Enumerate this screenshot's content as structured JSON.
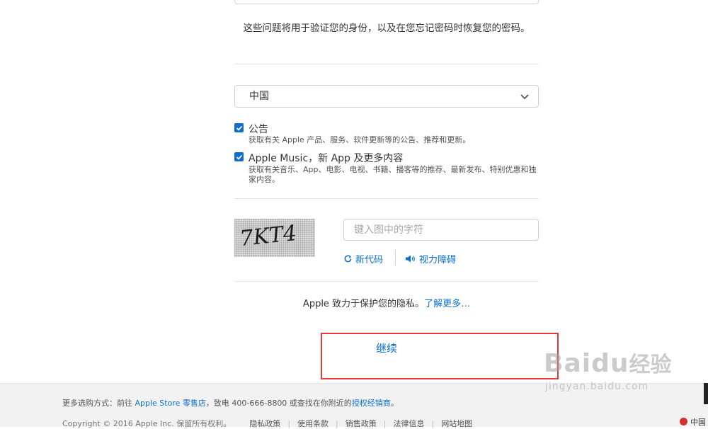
{
  "security_note": "这些问题将用于验证您的身份，以及在您忘记密码时恢复您的密码。",
  "country_select": {
    "value": "中国"
  },
  "subscriptions": [
    {
      "title": "公告",
      "subtitle": "获取有关 Apple 产品、服务、软件更新等的公告、推荐和更新。",
      "checked": true
    },
    {
      "title": "Apple Music，新 App 及更多内容",
      "subtitle": "获取有关音乐、App、电影、电视、书籍、播客等的推荐、最新发布、特别优惠和独家内容。",
      "checked": true
    }
  ],
  "captcha": {
    "image_text": "7KT4",
    "input_placeholder": "键入图中的字符",
    "new_code_label": "新代码",
    "audio_label": "视力障碍"
  },
  "privacy": {
    "text": "Apple 致力于保护您的隐私。",
    "link": "了解更多…"
  },
  "continue_label": "继续",
  "footer": {
    "line1": {
      "prefix": "更多选购方式：前往 ",
      "store_link": "Apple Store 零售店",
      "middle": "，致电 400-666-8800 或查找在你附近的",
      "dealer_link": "授权经销商",
      "suffix": "。"
    },
    "copyright": "Copyright © 2016 Apple Inc. 保留所有权利。",
    "links": [
      "隐私政策",
      "使用条款",
      "销售政策",
      "法律信息",
      "网站地图"
    ],
    "region": "中国"
  },
  "watermark": {
    "brand": "Baidu",
    "cn": "经验",
    "url": "jingyan.baidu.com"
  },
  "colors": {
    "accent": "#0a6fd1",
    "checkbox": "#0f6ecd",
    "highlight_box": "#e53935"
  }
}
